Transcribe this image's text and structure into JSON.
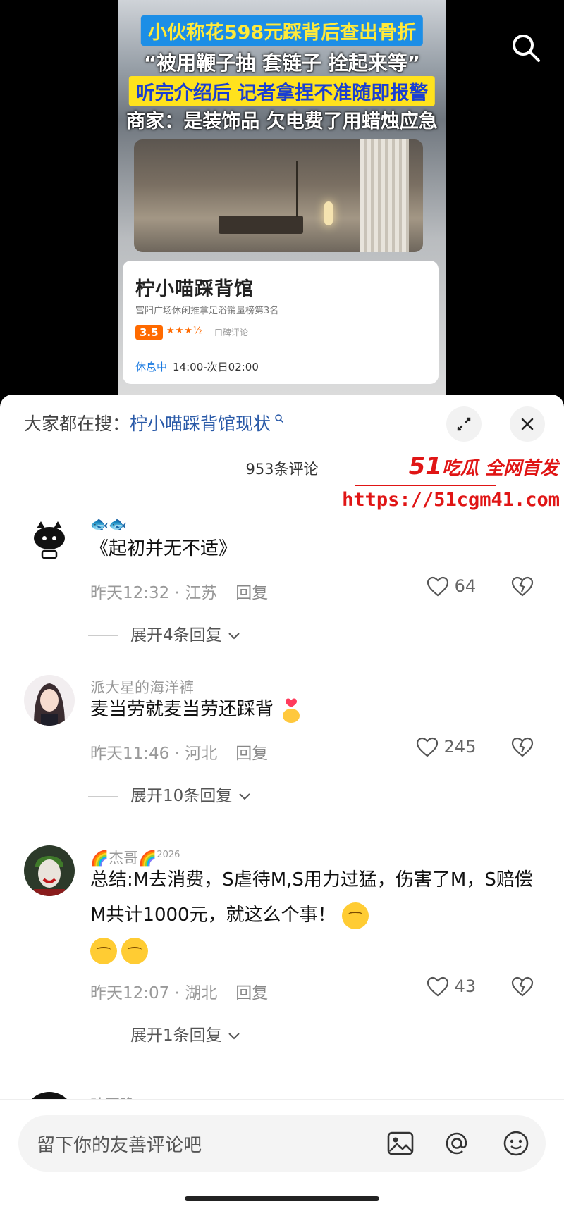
{
  "video": {
    "captions": [
      "小伙称花598元踩背后查出骨折",
      "“被用鞭子抽 套链子 拴起来等”",
      "听完介绍后 记者拿捏不准随即报警",
      "商家：是装饰品 欠电费了用蜡烛应急"
    ],
    "store_card": {
      "name": "柠小喵踩背馆",
      "address": "富阳广场休闲推拿足浴销量榜第3名",
      "rating": "3.5",
      "reviews": "口碑评论",
      "status": "休息中",
      "hours": "14:00-次日02:00"
    }
  },
  "sheet": {
    "search_prefix": "大家都在搜：",
    "search_term": "柠小喵踩背馆现状",
    "comment_count": "953条评论"
  },
  "watermark": {
    "title_num": "51",
    "title_text": "吃瓜 全网首发",
    "url": "https://51cgm41.com"
  },
  "comments": [
    {
      "username": "🐟🐟",
      "text": "《起初并无不适》",
      "time": "昨天12:32",
      "location": "江苏",
      "reply": "回复",
      "likes": "64",
      "expand": "展开4条回复"
    },
    {
      "username": "派大星的海洋裤",
      "text": "麦当劳就麦当劳还踩背",
      "time": "昨天11:46",
      "location": "河北",
      "reply": "回复",
      "likes": "245",
      "expand": "展开10条回复"
    },
    {
      "username": "杰哥",
      "username_badge": "2026",
      "text": "总结:M去消费，S虐待M,S用力过猛，伤害了M，S赔偿M共计1000元，就这么个事！",
      "time": "昨天12:07",
      "location": "湖北",
      "reply": "回复",
      "likes": "43",
      "expand": "展开1条回复"
    },
    {
      "username": "叶不晚"
    }
  ],
  "input": {
    "placeholder": "留下你的友善评论吧"
  },
  "colors": {
    "accent_link": "#2a5aa8",
    "watermark_red": "#e01515"
  },
  "icons": [
    "search-icon",
    "expand-icon",
    "close-icon",
    "heart-icon",
    "dislike-icon",
    "image-icon",
    "at-icon",
    "emoji-icon"
  ]
}
